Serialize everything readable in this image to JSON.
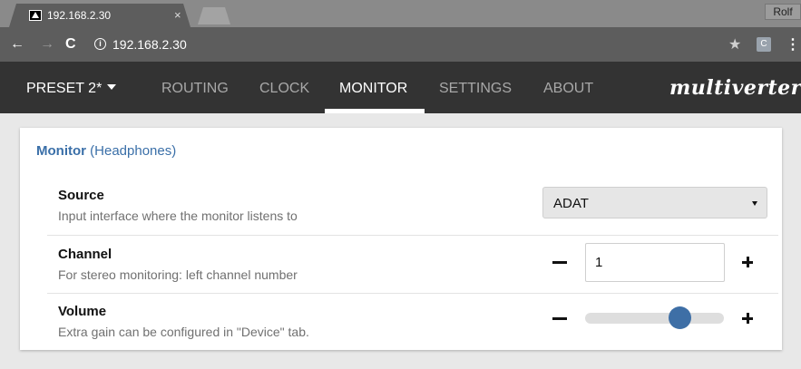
{
  "browser": {
    "tab_title": "192.168.2.30",
    "tab_close": "×",
    "url": "192.168.2.30",
    "profile": "Rolf",
    "extension_label": "C",
    "info_glyph": "i",
    "back_glyph": "←",
    "forward_glyph": "→",
    "reload_glyph": "C",
    "star_glyph": "★",
    "menu_glyph": "⋮"
  },
  "nav": {
    "preset": "PRESET 2*",
    "links": [
      "ROUTING",
      "CLOCK",
      "MONITOR",
      "SETTINGS",
      "ABOUT"
    ],
    "active": "MONITOR",
    "logo": "multiverter"
  },
  "panel": {
    "title_bold": "Monitor",
    "title_rest": "(Headphones)",
    "source": {
      "label": "Source",
      "description": "Input interface where the monitor listens to",
      "selected": "ADAT"
    },
    "channel": {
      "label": "Channel",
      "description": "For stereo monitoring: left channel number",
      "value": "1"
    },
    "volume": {
      "label": "Volume",
      "description": "Extra gain can be configured in \"Device\" tab.",
      "level": 0.72
    }
  },
  "colors": {
    "accent": "#3e6fa6",
    "navbar": "#333333",
    "title": "#3a6fa8"
  }
}
